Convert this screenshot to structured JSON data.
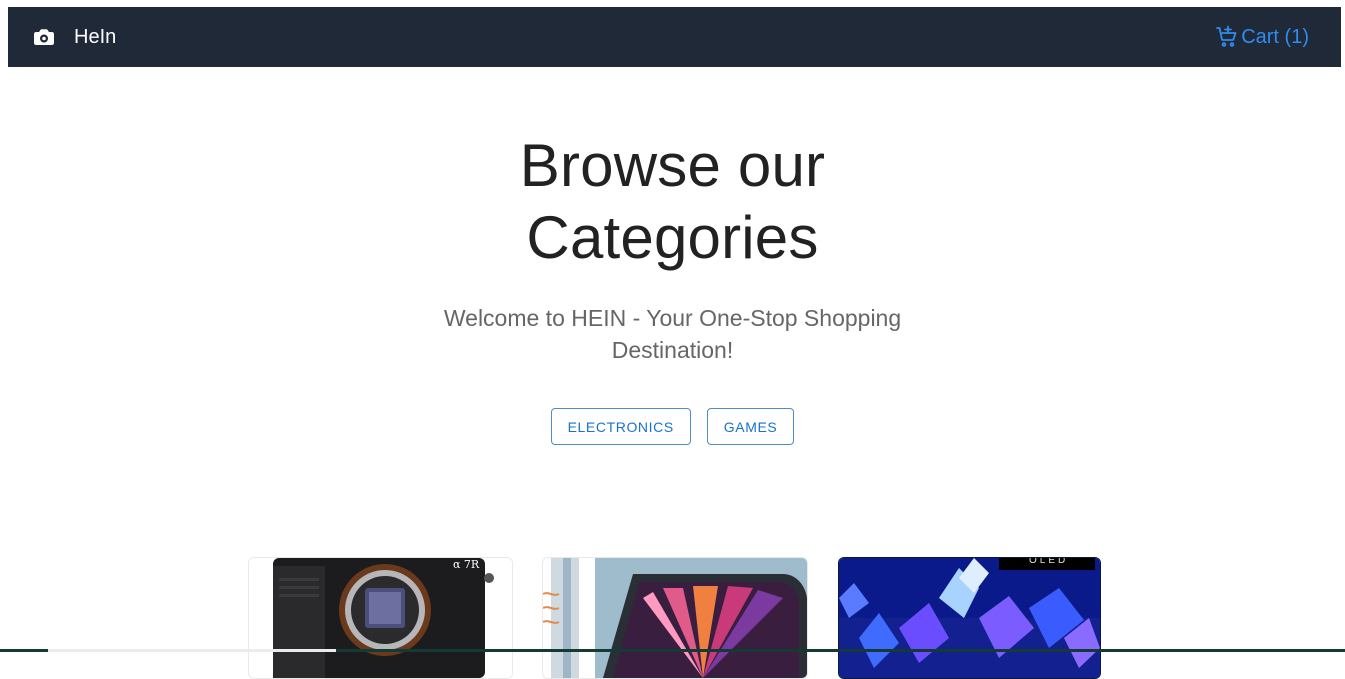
{
  "navbar": {
    "brand_name": "HeIn",
    "brand_icon": "camera-icon",
    "cart_icon": "cart-add-icon",
    "cart_label": "Cart (1)",
    "colors": {
      "bg": "#1f2937",
      "brand": "#ffffff",
      "cart": "#2f8cf0"
    }
  },
  "hero": {
    "title_line1": "Browse our",
    "title_line2": "Categories",
    "subtitle": "Welcome to HEIN - Your One-Stop Shopping Destination!"
  },
  "categories": [
    {
      "label": "ELECTRONICS"
    },
    {
      "label": "GAMES"
    }
  ],
  "products": [
    {
      "image": "mirrorless-camera-image",
      "badge_text": "α 7R"
    },
    {
      "image": "tablet-with-case-image"
    },
    {
      "image": "oled-tv-crystals-image",
      "badge_text": "OLED"
    }
  ]
}
